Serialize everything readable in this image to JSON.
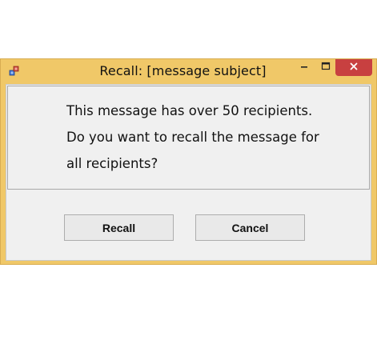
{
  "window": {
    "title": "Recall: [message subject]",
    "controls": {
      "minimize_icon": "minimize-icon",
      "maximize_icon": "maximize-icon",
      "close_icon": "close-icon"
    },
    "accent_color": "#f0c868",
    "close_color": "#c84040"
  },
  "message": {
    "line1": "This message has over 50 recipients.",
    "line2": "Do you want to recall the message for",
    "line3": "all recipients?"
  },
  "buttons": {
    "recall_label": "Recall",
    "cancel_label": "Cancel"
  }
}
